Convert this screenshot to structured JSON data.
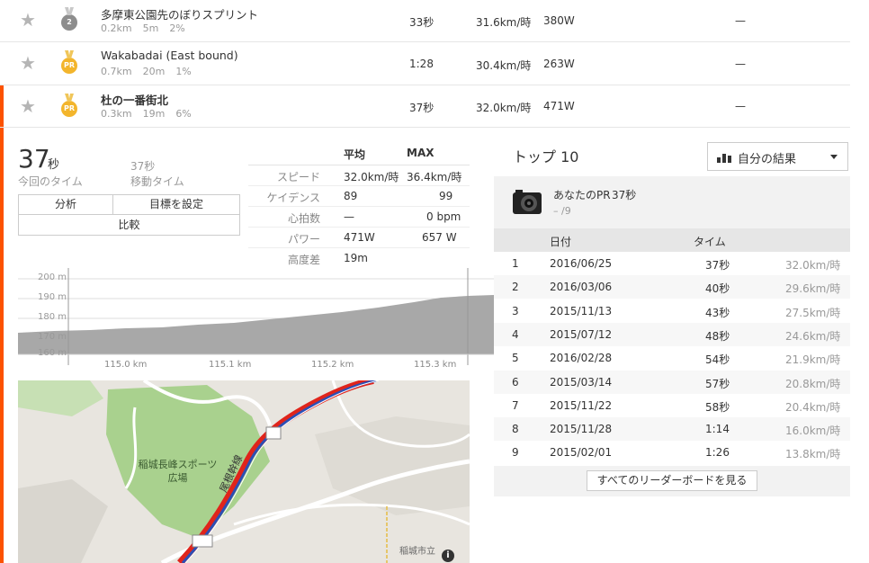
{
  "segments": [
    {
      "name": "多摩東公園先のぼりスプリント",
      "dist": "0.2km",
      "elev": "5m",
      "grade": "2%",
      "time": "33秒",
      "speed": "31.6km/時",
      "power": "380W",
      "pr": "—",
      "medal": "2"
    },
    {
      "name": "Wakabadai (East bound)",
      "dist": "0.7km",
      "elev": "20m",
      "grade": "1%",
      "time": "1:28",
      "speed": "30.4km/時",
      "power": "263W",
      "pr": "—",
      "medal": "PR"
    },
    {
      "name": "杜の一番街北",
      "dist": "0.3km",
      "elev": "19m",
      "grade": "6%",
      "time": "37秒",
      "speed": "32.0km/時",
      "power": "471W",
      "pr": "—",
      "medal": "PR"
    }
  ],
  "detail": {
    "elapsed_value": "37",
    "elapsed_unit": "秒",
    "elapsed_label": "今回のタイム",
    "moving_value": "37秒",
    "moving_label": "移動タイム",
    "buttons": {
      "analysis": "分析",
      "set_goal": "目標を設定",
      "compare": "比較"
    },
    "stats_headers": {
      "avg": "平均",
      "max": "MAX"
    },
    "stats": [
      {
        "label": "スピード",
        "avg": "32.0km/時",
        "max": "36.4km/時"
      },
      {
        "label": "ケイデンス",
        "avg": "89",
        "max": "99"
      },
      {
        "label": "心拍数",
        "avg": "—",
        "max": "0 bpm"
      },
      {
        "label": "パワー",
        "avg": "471W",
        "max": "657 W"
      },
      {
        "label": "高度差",
        "avg": "19m",
        "max": ""
      }
    ]
  },
  "elevation_chart": {
    "y_ticks": [
      "200 m",
      "190 m",
      "180 m",
      "170 m",
      "160 m"
    ],
    "x_ticks": [
      "115.0 km",
      "115.1 km",
      "115.2 km",
      "115.3 km"
    ]
  },
  "map": {
    "park_label": "稲城長峰スポーツ広場",
    "route_label": "尾根幹線",
    "school_label": "稲城市立",
    "info_icon": "i"
  },
  "top10": {
    "title": "トップ 10",
    "dropdown": "自分の結果",
    "your_pr_label": "あなたのPR",
    "your_pr_time": "37秒",
    "your_rank": "– /9",
    "col_date": "日付",
    "col_time": "タイム",
    "rows": [
      {
        "rank": "1",
        "date": "2016/06/25",
        "time": "37秒",
        "speed": "32.0km/時"
      },
      {
        "rank": "2",
        "date": "2016/03/06",
        "time": "40秒",
        "speed": "29.6km/時"
      },
      {
        "rank": "3",
        "date": "2015/11/13",
        "time": "43秒",
        "speed": "27.5km/時"
      },
      {
        "rank": "4",
        "date": "2015/07/12",
        "time": "48秒",
        "speed": "24.6km/時"
      },
      {
        "rank": "5",
        "date": "2016/02/28",
        "time": "54秒",
        "speed": "21.9km/時"
      },
      {
        "rank": "6",
        "date": "2015/03/14",
        "time": "57秒",
        "speed": "20.8km/時"
      },
      {
        "rank": "7",
        "date": "2015/11/22",
        "time": "58秒",
        "speed": "20.4km/時"
      },
      {
        "rank": "8",
        "date": "2015/11/28",
        "time": "1:14",
        "speed": "16.0km/時"
      },
      {
        "rank": "9",
        "date": "2015/02/01",
        "time": "1:26",
        "speed": "13.8km/時"
      }
    ],
    "view_all": "すべてのリーダーボードを見る"
  },
  "colors": {
    "accent": "#fc5200",
    "gold": "#f3b52c",
    "silver": "#8d8d8d",
    "route_red": "#e0241b",
    "route_blue": "#2c4fb5",
    "park_green": "#a9d18e"
  }
}
